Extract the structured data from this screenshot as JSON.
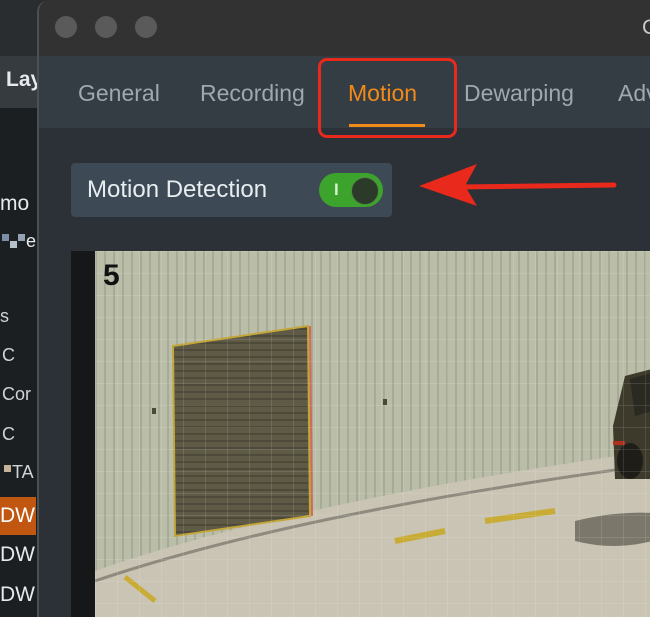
{
  "background_app": {
    "header_fragment": "Lay",
    "list_items": [
      "mo",
      "e",
      "s",
      "C",
      "Cor",
      "C",
      "TA",
      "DW",
      "DW",
      "DW"
    ]
  },
  "dialog": {
    "title_fragment": "C",
    "tabs": [
      {
        "label": "General"
      },
      {
        "label": "Recording"
      },
      {
        "label": "Motion",
        "active": true
      },
      {
        "label": "Dewarping"
      },
      {
        "label": "Adv"
      }
    ],
    "motion_detection": {
      "label": "Motion Detection",
      "enabled": true,
      "switch_mark": "I"
    },
    "camera_preview": {
      "camera_number": "5"
    }
  },
  "colors": {
    "accent": "#f28a1a",
    "annotation_red": "#e8291c",
    "switch_on": "#3ca32c"
  }
}
